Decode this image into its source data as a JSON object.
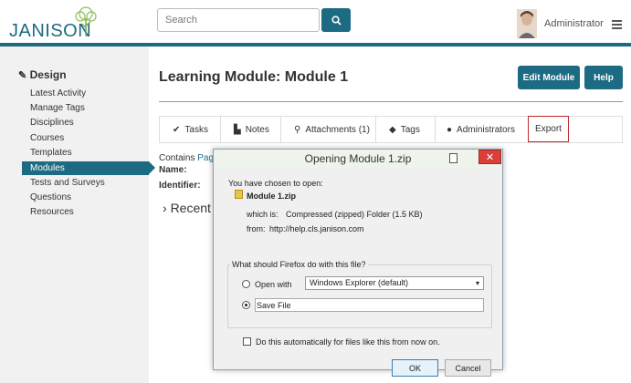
{
  "header": {
    "logo_text": "JANISON",
    "search_placeholder": "Search",
    "user_name": "Administrator"
  },
  "sidebar": {
    "title": "Design",
    "items": [
      {
        "label": "Latest Activity"
      },
      {
        "label": "Manage Tags"
      },
      {
        "label": "Disciplines"
      },
      {
        "label": "Courses"
      },
      {
        "label": "Templates"
      },
      {
        "label": "Modules",
        "active": true
      },
      {
        "label": "Tests and Surveys"
      },
      {
        "label": "Questions"
      },
      {
        "label": "Resources"
      }
    ]
  },
  "main": {
    "page_title": "Learning Module: Module 1",
    "edit_button": "Edit Module",
    "help_button": "Help",
    "tabs": [
      {
        "label": "Tasks",
        "icon": "check-icon"
      },
      {
        "label": "Notes",
        "icon": "document-icon"
      },
      {
        "label": "Attachments (1)",
        "icon": "paperclip-icon"
      },
      {
        "label": "Tags",
        "icon": "tag-icon"
      },
      {
        "label": "Administrators",
        "icon": "person-icon"
      },
      {
        "label": "Export",
        "highlighted": true
      }
    ],
    "contains_label": "Contains",
    "contains_link": "Page",
    "name_label": "Name:",
    "identifier_label": "Identifier:",
    "recent_label": "Recent"
  },
  "dialog": {
    "title": "Opening Module 1.zip",
    "intro": "You have chosen to open:",
    "file_name": "Module 1.zip",
    "which_is_label": "which is:",
    "which_is_value": "Compressed (zipped) Folder (1.5 KB)",
    "from_label": "from:",
    "from_value": "http://help.cls.janison.com",
    "question": "What should Firefox do with this file?",
    "open_with_label": "Open with",
    "open_with_value": "Windows Explorer (default)",
    "save_file_label": "Save File",
    "auto_label": "Do this automatically for files like this from now on.",
    "ok_button": "OK",
    "cancel_button": "Cancel",
    "close_glyph": "✕",
    "selected_option": "save_file"
  },
  "colors": {
    "brand": "#1d6b82",
    "export_highlight": "#c0292b",
    "close_button": "#d9403a"
  }
}
